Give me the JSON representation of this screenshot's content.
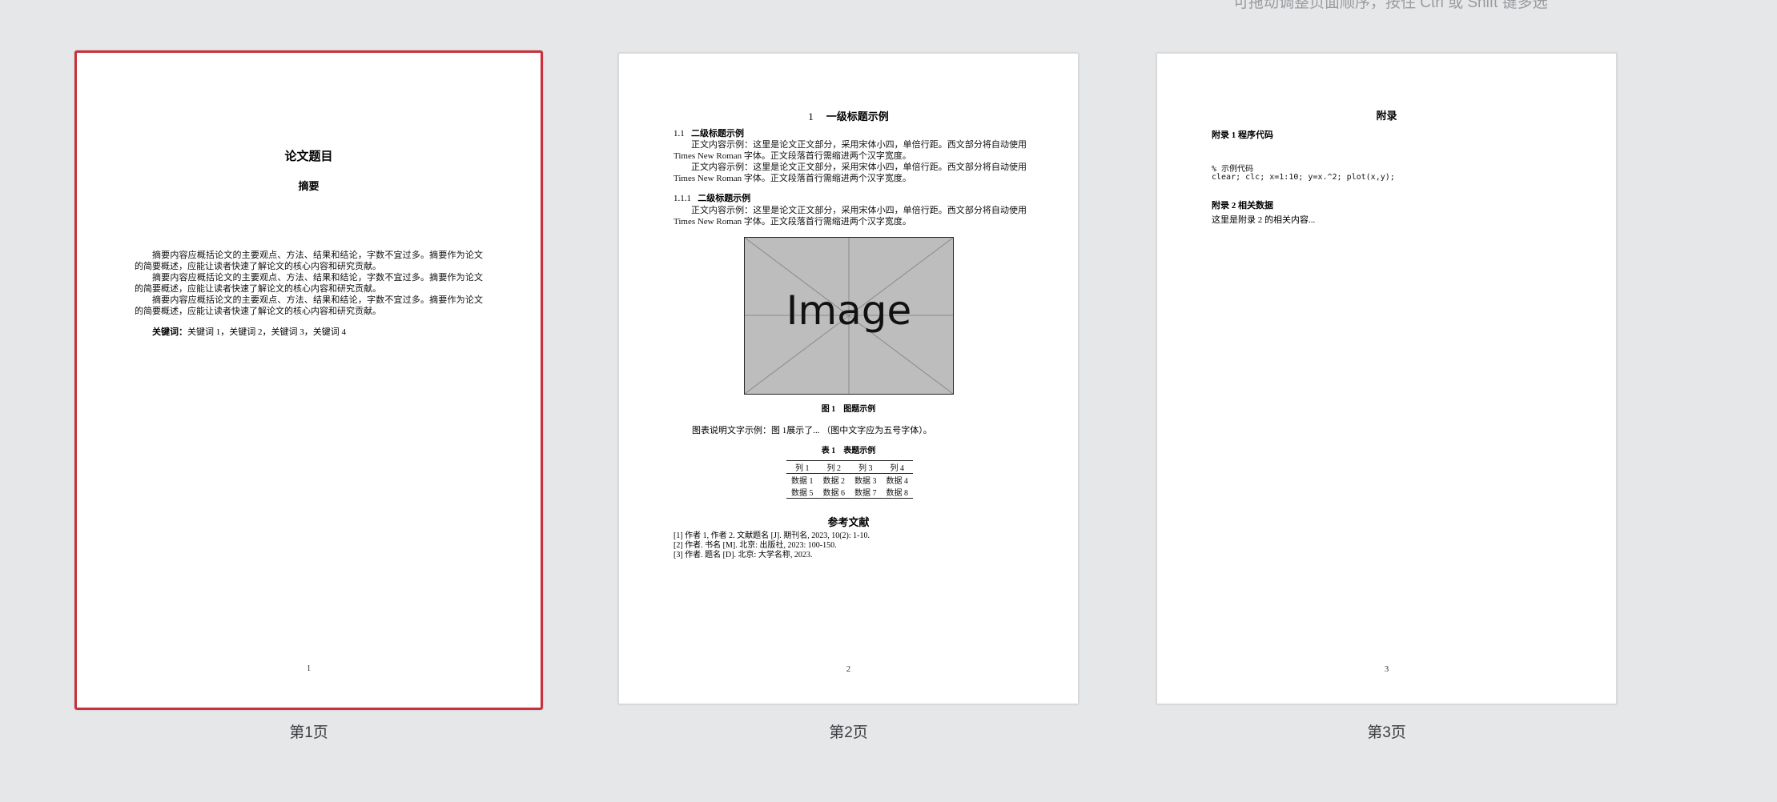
{
  "hint_text": "可拖动调整页面顺序，按住 Ctrl 或 Shift 键多选",
  "pages": [
    {
      "label": "第1页",
      "number": "1",
      "title": "论文题目",
      "abstract_heading": "摘要",
      "abstract_paragraphs": [
        "摘要内容应概括论文的主要观点、方法、结果和结论，字数不宜过多。摘要作为论文的简要概述，应能让读者快速了解论文的核心内容和研究贡献。",
        "摘要内容应概括论文的主要观点、方法、结果和结论，字数不宜过多。摘要作为论文的简要概述，应能让读者快速了解论文的核心内容和研究贡献。",
        "摘要内容应概括论文的主要观点、方法、结果和结论，字数不宜过多。摘要作为论文的简要概述，应能让读者快速了解论文的核心内容和研究贡献。"
      ],
      "keywords_label": "关键词：",
      "keywords": "关键词 1，关键词 2，关键词 3，关键词 4"
    },
    {
      "label": "第2页",
      "number": "2",
      "h1_number": "1",
      "h1_title": "一级标题示例",
      "h2_number": "1.1",
      "h2_title": "二级标题示例",
      "body_paragraphs": [
        "正文内容示例：这里是论文正文部分，采用宋体小四，单倍行距。西文部分将自动使用 Times New Roman 字体。正文段落首行需缩进两个汉字宽度。",
        "正文内容示例：这里是论文正文部分，采用宋体小四，单倍行距。西文部分将自动使用 Times New Roman 字体。正文段落首行需缩进两个汉字宽度。",
        "正文内容示例：这里是论文正文部分，采用宋体小四，单倍行距。西文部分将自动使用 Times New Roman 字体。正文段落首行需缩进两个汉字宽度。"
      ],
      "h3_number": "1.1.1",
      "h3_title": "二级标题示例",
      "figure_placeholder": "Image",
      "figure_caption": "图 1　图题示例",
      "figure_desc": "图表说明文字示例：图 1展示了... （图中文字应为五号字体）。",
      "table_caption": "表 1　表题示例",
      "table_headers": [
        "列 1",
        "列 2",
        "列 3",
        "列 4"
      ],
      "table_rows": [
        [
          "数据 1",
          "数据 2",
          "数据 3",
          "数据 4"
        ],
        [
          "数据 5",
          "数据 6",
          "数据 7",
          "数据 8"
        ]
      ],
      "references_heading": "参考文献",
      "references": [
        "[1] 作者 1, 作者 2. 文献题名 [J]. 期刊名, 2023, 10(2): 1-10.",
        "[2] 作者. 书名 [M]. 北京: 出版社, 2023: 100-150.",
        "[3] 作者. 题名 [D]. 北京: 大学名称, 2023."
      ]
    },
    {
      "label": "第3页",
      "number": "3",
      "heading": "附录",
      "appendix1_title": "附录 1 程序代码",
      "code_lines": [
        "% 示例代码",
        "clear; clc; x=1:10; y=x.^2; plot(x,y);"
      ],
      "appendix2_title": "附录 2 相关数据",
      "appendix2_text": "这里是附录 2 的相关内容..."
    }
  ]
}
